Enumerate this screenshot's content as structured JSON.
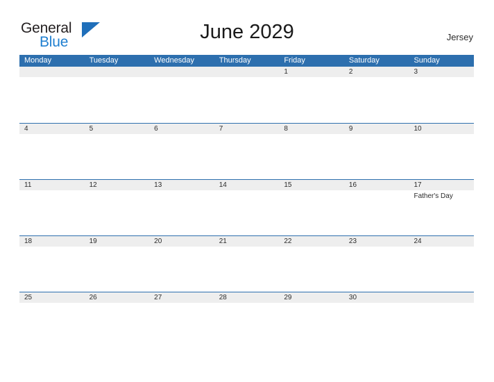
{
  "branding": {
    "logo_word1": "General",
    "logo_word2": "Blue",
    "logo_icon": "triangle-flag-icon",
    "logo_color_primary": "#231f20",
    "logo_color_accent": "#1f7fd0"
  },
  "header": {
    "title": "June 2029",
    "region": "Jersey"
  },
  "theme": {
    "header_blue": "#2d6fae",
    "daynum_band_gray": "#eeeeee",
    "text_dark": "#2b2b2b",
    "background": "#ffffff"
  },
  "calendar": {
    "month": "June",
    "year": "2029",
    "week_start": "Monday",
    "weekdays": [
      "Monday",
      "Tuesday",
      "Wednesday",
      "Thursday",
      "Friday",
      "Saturday",
      "Sunday"
    ],
    "weeks": [
      {
        "days": [
          {
            "num": "",
            "event": ""
          },
          {
            "num": "",
            "event": ""
          },
          {
            "num": "",
            "event": ""
          },
          {
            "num": "",
            "event": ""
          },
          {
            "num": "1",
            "event": ""
          },
          {
            "num": "2",
            "event": ""
          },
          {
            "num": "3",
            "event": ""
          }
        ]
      },
      {
        "days": [
          {
            "num": "4",
            "event": ""
          },
          {
            "num": "5",
            "event": ""
          },
          {
            "num": "6",
            "event": ""
          },
          {
            "num": "7",
            "event": ""
          },
          {
            "num": "8",
            "event": ""
          },
          {
            "num": "9",
            "event": ""
          },
          {
            "num": "10",
            "event": ""
          }
        ]
      },
      {
        "days": [
          {
            "num": "11",
            "event": ""
          },
          {
            "num": "12",
            "event": ""
          },
          {
            "num": "13",
            "event": ""
          },
          {
            "num": "14",
            "event": ""
          },
          {
            "num": "15",
            "event": ""
          },
          {
            "num": "16",
            "event": ""
          },
          {
            "num": "17",
            "event": "Father's Day"
          }
        ]
      },
      {
        "days": [
          {
            "num": "18",
            "event": ""
          },
          {
            "num": "19",
            "event": ""
          },
          {
            "num": "20",
            "event": ""
          },
          {
            "num": "21",
            "event": ""
          },
          {
            "num": "22",
            "event": ""
          },
          {
            "num": "23",
            "event": ""
          },
          {
            "num": "24",
            "event": ""
          }
        ]
      },
      {
        "days": [
          {
            "num": "25",
            "event": ""
          },
          {
            "num": "26",
            "event": ""
          },
          {
            "num": "27",
            "event": ""
          },
          {
            "num": "28",
            "event": ""
          },
          {
            "num": "29",
            "event": ""
          },
          {
            "num": "30",
            "event": ""
          },
          {
            "num": "",
            "event": ""
          }
        ]
      }
    ]
  }
}
